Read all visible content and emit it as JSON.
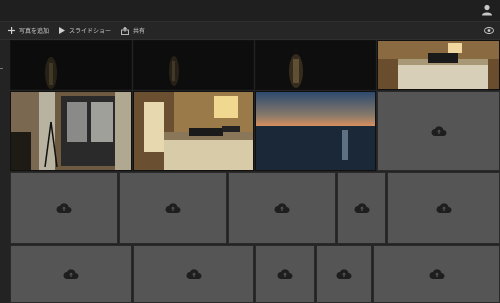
{
  "toolbar": {
    "add_photos_label": "写真を追加",
    "slideshow_label": "スライドショー",
    "share_label": "共有"
  },
  "icons": {
    "user": "user-icon",
    "add": "plus-icon",
    "slideshow": "play-icon",
    "share": "share-icon",
    "visibility": "eye-icon",
    "placeholder": "cloud-upload-icon"
  },
  "colors": {
    "background": "#232323",
    "placeholder_tile": "#555555",
    "icon": "#1e1e1e"
  }
}
